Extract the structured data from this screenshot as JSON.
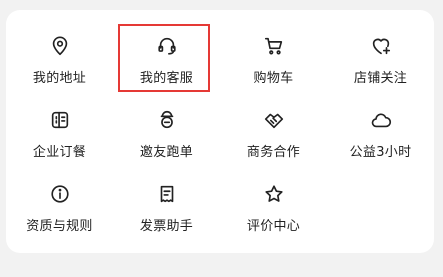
{
  "colors": {
    "background": "#f2f2f2",
    "card": "#ffffff",
    "text": "#222222",
    "highlight": "#e53935"
  },
  "items": [
    {
      "label": "我的地址",
      "icon": "location-icon"
    },
    {
      "label": "我的客服",
      "icon": "headset-icon"
    },
    {
      "label": "购物车",
      "icon": "cart-icon"
    },
    {
      "label": "店铺关注",
      "icon": "heart-plus-icon"
    },
    {
      "label": "企业订餐",
      "icon": "building-icon"
    },
    {
      "label": "邀友跑单",
      "icon": "helmet-icon"
    },
    {
      "label": "商务合作",
      "icon": "handshake-icon"
    },
    {
      "label": "公益3小时",
      "icon": "cloud-icon"
    },
    {
      "label": "资质与规则",
      "icon": "info-icon"
    },
    {
      "label": "发票助手",
      "icon": "receipt-icon"
    },
    {
      "label": "评价中心",
      "icon": "star-icon"
    }
  ]
}
